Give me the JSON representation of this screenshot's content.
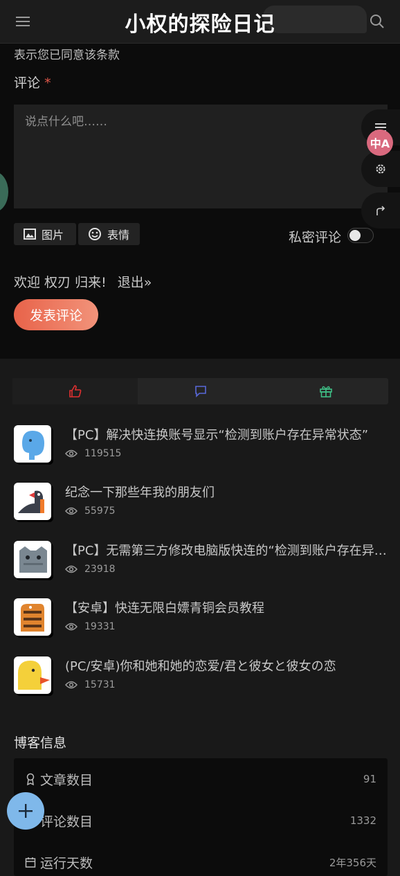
{
  "header": {
    "site_title": "小权的探险日记",
    "menu_icon": "menu-icon",
    "search_icon": "search-icon"
  },
  "comment_form": {
    "consent_text": "表示您已同意该条款",
    "comment_label": "评论",
    "required_mark": "*",
    "textarea_placeholder": "说点什么吧……",
    "image_button": "图片",
    "emoji_button": "表情",
    "private_label": "私密评论",
    "private_enabled": false,
    "welcome_text": "欢迎 权刃 归来!",
    "logout_text": "退出»",
    "submit_label": "发表评论"
  },
  "float_tools": {
    "translate_label": "中A"
  },
  "tabs": [
    {
      "icon": "thumbs-up-icon",
      "active": true,
      "color": "#e03030"
    },
    {
      "icon": "comment-icon",
      "active": false,
      "color": "#5868d8"
    },
    {
      "icon": "gift-icon",
      "active": false,
      "color": "#3fbf86"
    }
  ],
  "posts": [
    {
      "title": "【PC】解决快连换账号显示“检测到账户存在异常状态”",
      "views": "119515",
      "avatar": "elephant"
    },
    {
      "title": "纪念一下那些年我的朋友们",
      "views": "55975",
      "avatar": "bird"
    },
    {
      "title": "【PC】无需第三方修改电脑版快连的“检测到账户存在异常状态”",
      "views": "23918",
      "avatar": "cat"
    },
    {
      "title": "【安卓】快连无限白嫖青铜会员教程",
      "views": "19331",
      "avatar": "tiger"
    },
    {
      "title": "(PC/安卓)你和她和她的恋爱/君と彼女と彼女の恋",
      "views": "15731",
      "avatar": "duck"
    }
  ],
  "blog_info": {
    "title": "博客信息",
    "stats": [
      {
        "name": "文章数目",
        "value": "91",
        "icon": "award-icon"
      },
      {
        "name": "评论数目",
        "value": "1332",
        "icon": "comment-icon"
      },
      {
        "name": "运行天数",
        "value": "2年356天",
        "icon": "calendar-icon"
      }
    ]
  },
  "fab_icon": "plus-icon"
}
